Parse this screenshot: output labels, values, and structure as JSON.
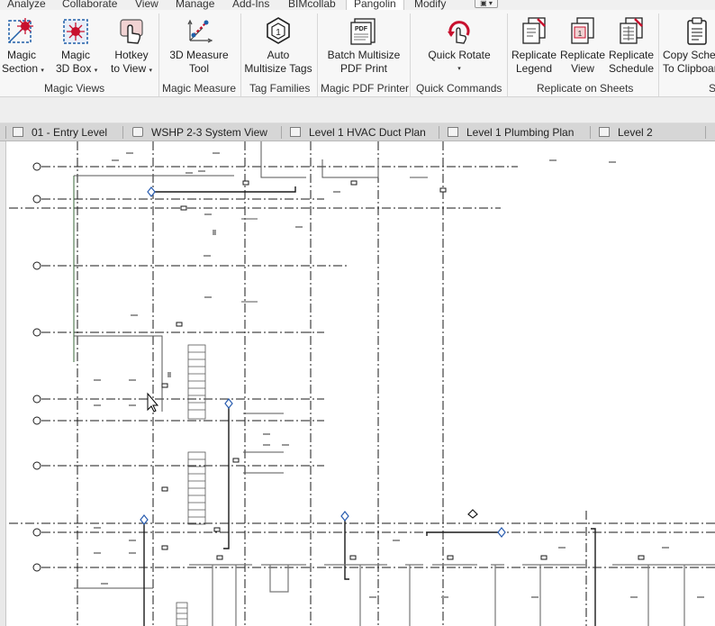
{
  "ribbon_tabs": [
    "Analyze",
    "Collaborate",
    "View",
    "Manage",
    "Add-Ins",
    "BIMcollab",
    "Pangolin",
    "Modify"
  ],
  "active_tab": "Pangolin",
  "quick_access_label": "▣ ▾",
  "buttons": [
    {
      "line1": "Magic",
      "line2": "Section",
      "icon": "magic-section-icon",
      "has_caret": true
    },
    {
      "line1": "Magic",
      "line2": "3D Box",
      "icon": "magic-3d-box-icon",
      "has_caret": true
    },
    {
      "line1": "Hotkey",
      "line2": "to View",
      "icon": "hotkey-to-view-icon",
      "has_caret": true
    },
    {
      "line1": "3D Measure",
      "line2": "Tool",
      "icon": "3d-measure-icon",
      "has_caret": false
    },
    {
      "line1": "Auto",
      "line2": "Multisize Tags",
      "icon": "auto-multisize-tags-icon",
      "has_caret": false
    },
    {
      "line1": "Batch Multisize",
      "line2": "PDF Print",
      "icon": "batch-pdf-print-icon",
      "has_caret": false
    },
    {
      "line1": "Quick Rotate",
      "line2": "",
      "icon": "quick-rotate-icon",
      "has_caret": true
    },
    {
      "line1": "Replicate",
      "line2": "Legend",
      "icon": "replicate-legend-icon",
      "has_caret": false
    },
    {
      "line1": "Replicate",
      "line2": "View",
      "icon": "replicate-view-icon",
      "has_caret": false
    },
    {
      "line1": "Replicate",
      "line2": "Schedule",
      "icon": "replicate-schedule-icon",
      "has_caret": false
    },
    {
      "line1": "Copy Schedule",
      "line2": "To Clipboard",
      "icon": "copy-schedule-clipboard-icon",
      "has_caret": false
    }
  ],
  "caret_glyph": "▾",
  "group_labels": [
    "Magic Views",
    "Magic Measure",
    "Tag Families",
    "Magic PDF Printer",
    "Quick Commands",
    "Replicate on Sheets",
    "S"
  ],
  "pdf_badge": "PDF",
  "view_tabs": [
    {
      "label": "01 - Entry Level",
      "kind": "floor-plan"
    },
    {
      "label": "WSHP 2-3 System View",
      "kind": "3d-view"
    },
    {
      "label": "Level 1 HVAC Duct Plan",
      "kind": "floor-plan"
    },
    {
      "label": "Level 1 Plumbing Plan",
      "kind": "floor-plan"
    },
    {
      "label": "Level 2",
      "kind": "floor-plan"
    }
  ],
  "colors": {
    "accent_red": "#c8102e",
    "accent_blue": "#1f5fa8",
    "tab_bar": "#d6d6d6",
    "ribbon_bg": "#f7f7f7",
    "drawing_line": "#1a1a1a",
    "grid_bubble_blue": "#2a5db0"
  }
}
